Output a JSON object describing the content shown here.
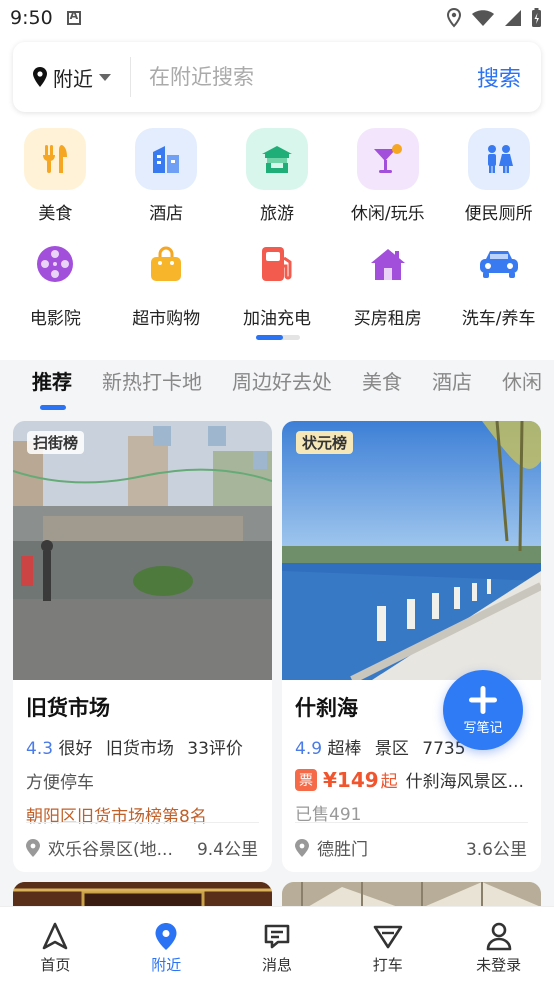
{
  "status_bar": {
    "time": "9:50"
  },
  "search": {
    "location": "附近",
    "placeholder": "在附近搜索",
    "button": "搜索"
  },
  "categories": [
    {
      "label": "美食",
      "icon": "fork-knife-icon",
      "color": "#f5a623"
    },
    {
      "label": "酒店",
      "icon": "hotel-icon",
      "color": "#3a7af0"
    },
    {
      "label": "旅游",
      "icon": "pavilion-icon",
      "color": "#23b07a"
    },
    {
      "label": "休闲/玩乐",
      "icon": "cocktail-icon",
      "color": "#a24fdc"
    },
    {
      "label": "便民厕所",
      "icon": "restroom-icon",
      "color": "#3a7af0"
    },
    {
      "label": "电影院",
      "icon": "film-reel-icon",
      "color": "#a24fdc"
    },
    {
      "label": "超市购物",
      "icon": "shopping-bag-icon",
      "color": "#f5a623"
    },
    {
      "label": "加油充电",
      "icon": "fuel-pump-icon",
      "color": "#f25b4e"
    },
    {
      "label": "买房租房",
      "icon": "house-icon",
      "color": "#a24fdc"
    },
    {
      "label": "洗车/养车",
      "icon": "car-icon",
      "color": "#3a7af0"
    }
  ],
  "tabs": [
    "推荐",
    "新热打卡地",
    "周边好去处",
    "美食",
    "酒店",
    "休闲"
  ],
  "cards": [
    {
      "rank_badge": "扫街榜",
      "title": "旧货市场",
      "score": "4.3",
      "score_text": "很好",
      "category": "旧货市场",
      "reviews": "33评价",
      "feature": "方便停车",
      "ranking": "朝阳区旧货市场榜第8名",
      "location": "欢乐谷景区(地...",
      "distance": "9.4公里"
    },
    {
      "rank_badge": "状元榜",
      "title": "什刹海",
      "score": "4.9",
      "score_text": "超棒",
      "category": "景区",
      "reviews": "7735",
      "ticket_icon": "票",
      "price": "¥149",
      "price_suffix": "起",
      "price_name": "什刹海风景区...",
      "sold": "已售491",
      "location": "德胜门",
      "distance": "3.6公里"
    }
  ],
  "fab": {
    "label": "写笔记"
  },
  "bottom_nav": [
    {
      "label": "首页",
      "icon": "navigation-arrow-icon"
    },
    {
      "label": "附近",
      "icon": "location-pin-icon",
      "active": true
    },
    {
      "label": "消息",
      "icon": "message-icon"
    },
    {
      "label": "打车",
      "icon": "taxi-icon"
    },
    {
      "label": "未登录",
      "icon": "user-icon"
    }
  ],
  "colors": {
    "accent": "#2b73f5",
    "price": "#f0552e",
    "ranking": "#c0602a"
  }
}
